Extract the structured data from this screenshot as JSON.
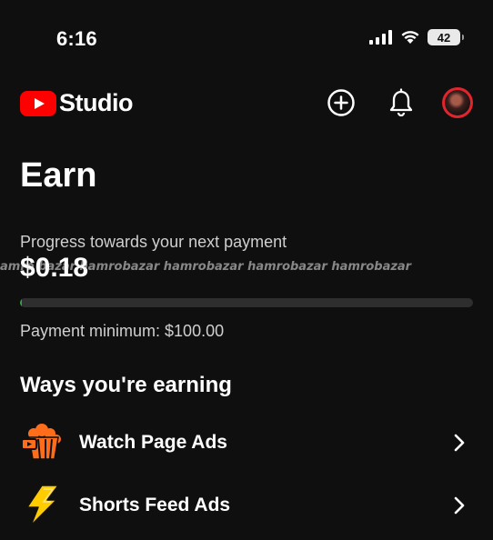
{
  "status_bar": {
    "time": "6:16",
    "battery": "42",
    "icons": [
      "cellular-signal-icon",
      "wifi-icon",
      "battery-icon"
    ]
  },
  "app_bar": {
    "brand": "Studio",
    "logo_color": "#ff0000",
    "actions": [
      "create-icon",
      "notifications-bell-icon",
      "avatar"
    ]
  },
  "earn": {
    "title": "Earn",
    "progress_label": "Progress towards your next payment",
    "amount": "$0.18",
    "progress_fraction": 0.0018,
    "progress_color": "#2ba640",
    "minimum": "Payment minimum: $100.00"
  },
  "watermark": "amro bazar  hamrobazar  hamrobazar  hamrobazar  hamrobazar",
  "ways": {
    "title": "Ways you're earning",
    "items": [
      {
        "label": "Watch Page Ads",
        "icon": "popcorn-icon",
        "icon_color": "#ff6d1b"
      },
      {
        "label": "Shorts Feed Ads",
        "icon": "lightning-bolt-icon",
        "icon_color": "#ffcc00"
      }
    ]
  }
}
